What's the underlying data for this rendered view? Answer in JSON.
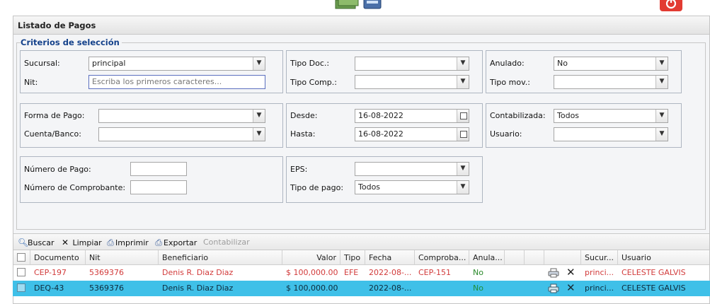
{
  "panel": {
    "title": "Listado de Pagos"
  },
  "criteria": {
    "legend": "Criterios de selección",
    "sucursal_label": "Sucursal:",
    "sucursal_value": "principal",
    "nit_label": "Nit:",
    "nit_placeholder": "Escriba los primeros caracteres...",
    "tipo_doc_label": "Tipo Doc.:",
    "tipo_doc_value": "",
    "tipo_comp_label": "Tipo Comp.:",
    "tipo_comp_value": "",
    "anulado_label": "Anulado:",
    "anulado_value": "No",
    "tipo_mov_label": "Tipo mov.:",
    "tipo_mov_value": "",
    "forma_pago_label": "Forma de Pago:",
    "forma_pago_value": "",
    "cuenta_label": "Cuenta/Banco:",
    "cuenta_value": "",
    "desde_label": "Desde:",
    "desde_value": "16-08-2022",
    "hasta_label": "Hasta:",
    "hasta_value": "16-08-2022",
    "contabilizada_label": "Contabilizada:",
    "contabilizada_value": "Todos",
    "usuario_label": "Usuario:",
    "usuario_value": "",
    "numero_pago_label": "Número de Pago:",
    "numero_pago_value": "",
    "numero_comp_label": "Número de Comprobante:",
    "numero_comp_value": "",
    "eps_label": "EPS:",
    "eps_value": "",
    "tipo_pago_label": "Tipo de pago:",
    "tipo_pago_value": "Todos"
  },
  "toolbar": {
    "buscar": "Buscar",
    "limpiar": "Limpiar",
    "imprimir": "Imprimir",
    "exportar": "Exportar",
    "contabilizar": "Contabilizar"
  },
  "grid": {
    "headers": [
      "Documento",
      "Nit",
      "Beneficiario",
      "Valor",
      "Tipo",
      "Fecha",
      "Comproba...",
      "Anula...",
      "",
      "",
      "",
      "Sucur...",
      "Usuario"
    ],
    "rows": [
      {
        "documento": "CEP-197",
        "nit": "5369376",
        "beneficiario": "Denis R. Diaz Diaz",
        "valor": "$ 100,000.00",
        "tipo": "EFE",
        "fecha": "2022-08-...",
        "comprobante": "CEP-151",
        "anulado": "No",
        "sucursal": "princi...",
        "usuario": "CELESTE GALVIS"
      },
      {
        "documento": "DEQ-43",
        "nit": "5369376",
        "beneficiario": "Denis R. Diaz Diaz",
        "valor": "$ 100,000.00",
        "tipo": "",
        "fecha": "2022-08-...",
        "comprobante": "",
        "anulado": "No",
        "sucursal": "princi...",
        "usuario": "CELESTE GALVIS"
      }
    ]
  },
  "colors": {
    "accent_selected_row": "#3fc0e8",
    "header_blue": "#15428b",
    "red_row_text": "#d23b3b",
    "green_text": "#2a8a2a"
  }
}
